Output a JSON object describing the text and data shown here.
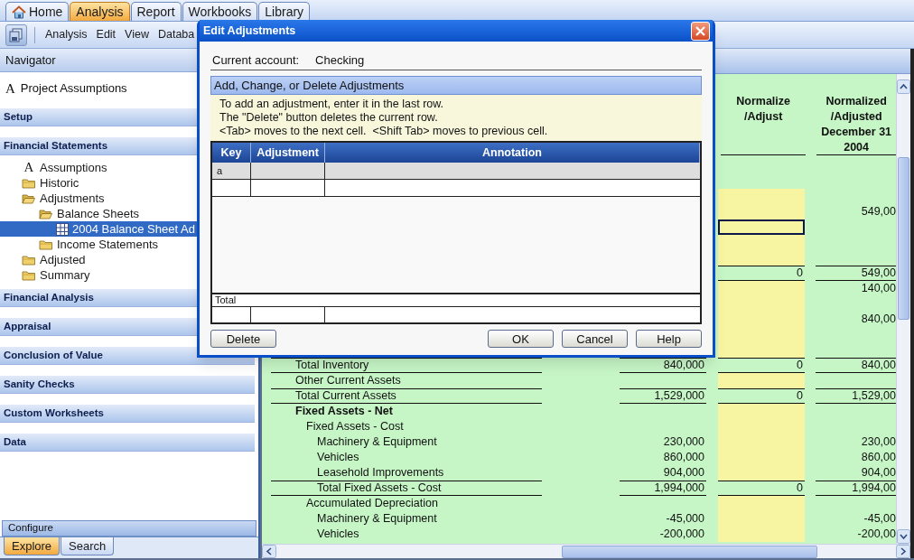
{
  "app_tabs": [
    {
      "label": "Home",
      "selected": false,
      "kind": "home"
    },
    {
      "label": "Analysis",
      "selected": true
    },
    {
      "label": "Report",
      "selected": false
    },
    {
      "label": "Workbooks",
      "selected": false
    },
    {
      "label": "Library",
      "selected": false
    }
  ],
  "menu": [
    "Analysis",
    "Edit",
    "View",
    "Databa"
  ],
  "navigator": {
    "title": "Navigator",
    "top_item": {
      "glyph": "A",
      "label": "Project Assumptions"
    },
    "sections": [
      {
        "title": "Setup"
      },
      {
        "title": "Financial Statements",
        "tree": [
          {
            "kind": "glyph",
            "glyph": "A",
            "label": "Assumptions",
            "selected": false
          },
          {
            "kind": "folder",
            "label": "Historic",
            "expanded": false,
            "selected": false
          },
          {
            "kind": "folder",
            "label": "Adjustments",
            "expanded": true,
            "selected": false,
            "children": [
              {
                "kind": "folder",
                "label": "Balance Sheets",
                "expanded": true,
                "selected": false,
                "children": [
                  {
                    "kind": "sheet",
                    "label": "2004 Balance Sheet Ad",
                    "selected": true
                  }
                ]
              },
              {
                "kind": "folder",
                "label": "Income Statements",
                "expanded": false,
                "selected": false
              }
            ]
          },
          {
            "kind": "folder",
            "label": "Adjusted",
            "expanded": false,
            "selected": false
          },
          {
            "kind": "folder",
            "label": "Summary",
            "expanded": false,
            "selected": false
          }
        ]
      },
      {
        "title": "Financial Analysis"
      },
      {
        "title": "Appraisal"
      },
      {
        "title": "Conclusion of Value"
      },
      {
        "title": "Sanity Checks"
      },
      {
        "title": "Custom Worksheets"
      },
      {
        "title": "Data"
      }
    ],
    "footer": "Configure",
    "bottom_tabs": [
      {
        "label": "Explore",
        "selected": true
      },
      {
        "label": "Search",
        "selected": false
      }
    ]
  },
  "sheet": {
    "headers": {
      "adjust": [
        "Normalize",
        "/Adjust"
      ],
      "normalized": [
        "Normalized",
        "/Adjusted",
        "December 31",
        "2004"
      ]
    },
    "rows": [
      {
        "kind": "item",
        "editable": true,
        "selected": false
      },
      {
        "kind": "item",
        "editable": true,
        "selected": false,
        "normalized": "549,00"
      },
      {
        "kind": "item",
        "editable": true,
        "selected": true
      },
      {
        "kind": "item",
        "editable": true,
        "selected": false
      },
      {
        "kind": "item",
        "editable": true,
        "selected": false
      },
      {
        "kind": "total",
        "editable": false,
        "selected": false,
        "adjust": "0",
        "normalized": "549,00"
      },
      {
        "kind": "item",
        "editable": true,
        "selected": false,
        "normalized": "140,00"
      },
      {
        "kind": "item",
        "editable": true,
        "selected": false
      },
      {
        "kind": "item",
        "editable": true,
        "selected": false,
        "normalized": "840,00"
      },
      {
        "kind": "item",
        "editable": true,
        "selected": false
      },
      {
        "kind": "item",
        "editable": true,
        "selected": false
      },
      {
        "kind": "total",
        "label": "Total Inventory",
        "editable": false,
        "selected": false,
        "historic": "840,000",
        "adjust": "0",
        "normalized": "840,00"
      },
      {
        "kind": "item",
        "label": "Other Current Assets",
        "editable": true,
        "selected": false
      },
      {
        "kind": "total",
        "label": "Total Current Assets",
        "editable": false,
        "selected": false,
        "historic": "1,529,000",
        "adjust": "0",
        "normalized": "1,529,00"
      },
      {
        "kind": "heading",
        "label": "Fixed Assets - Net",
        "editable": true,
        "selected": false,
        "children": [
          {
            "kind": "item",
            "label": "Fixed Assets - Cost",
            "editable": true,
            "selected": false,
            "children": [
              {
                "kind": "item",
                "label": "Machinery & Equipment",
                "editable": true,
                "selected": false,
                "historic": "230,000",
                "normalized": "230,00"
              },
              {
                "kind": "item",
                "label": "Vehicles",
                "editable": true,
                "selected": false,
                "historic": "860,000",
                "normalized": "860,00"
              },
              {
                "kind": "item",
                "label": "Leasehold Improvements",
                "editable": true,
                "selected": false,
                "historic": "904,000",
                "normalized": "904,00"
              },
              {
                "kind": "total",
                "label": "Total Fixed Assets - Cost",
                "editable": false,
                "selected": false,
                "historic": "1,994,000",
                "adjust": "0",
                "normalized": "1,994,00"
              }
            ]
          },
          {
            "kind": "item",
            "label": "Accumulated Depreciation",
            "editable": true,
            "selected": false,
            "children": [
              {
                "kind": "item",
                "label": "Machinery & Equipment",
                "editable": true,
                "selected": false,
                "historic": "-45,000",
                "normalized": "-45,00"
              },
              {
                "kind": "item",
                "label": "Vehicles",
                "editable": true,
                "selected": false,
                "historic": "-200,000",
                "normalized": "-200,00"
              }
            ]
          }
        ]
      }
    ]
  },
  "dialog": {
    "title": "Edit Adjustments",
    "account_label": "Current account:",
    "account_value": "Checking",
    "section_title": "Add, Change, or Delete Adjustments",
    "instructions": [
      "To add an adjustment, enter it in the last row.",
      "The \"Delete\" button deletes the current row.",
      "<Tab> moves to the next cell.  <Shift Tab> moves to previous cell."
    ],
    "columns": [
      "Key",
      "Adjustment",
      "Annotation"
    ],
    "rows": [
      {
        "key": "a",
        "selected": true
      },
      {
        "selected": false
      }
    ],
    "total_label": "Total",
    "left_button": "Delete",
    "buttons": [
      "OK",
      "Cancel",
      "Help"
    ]
  }
}
